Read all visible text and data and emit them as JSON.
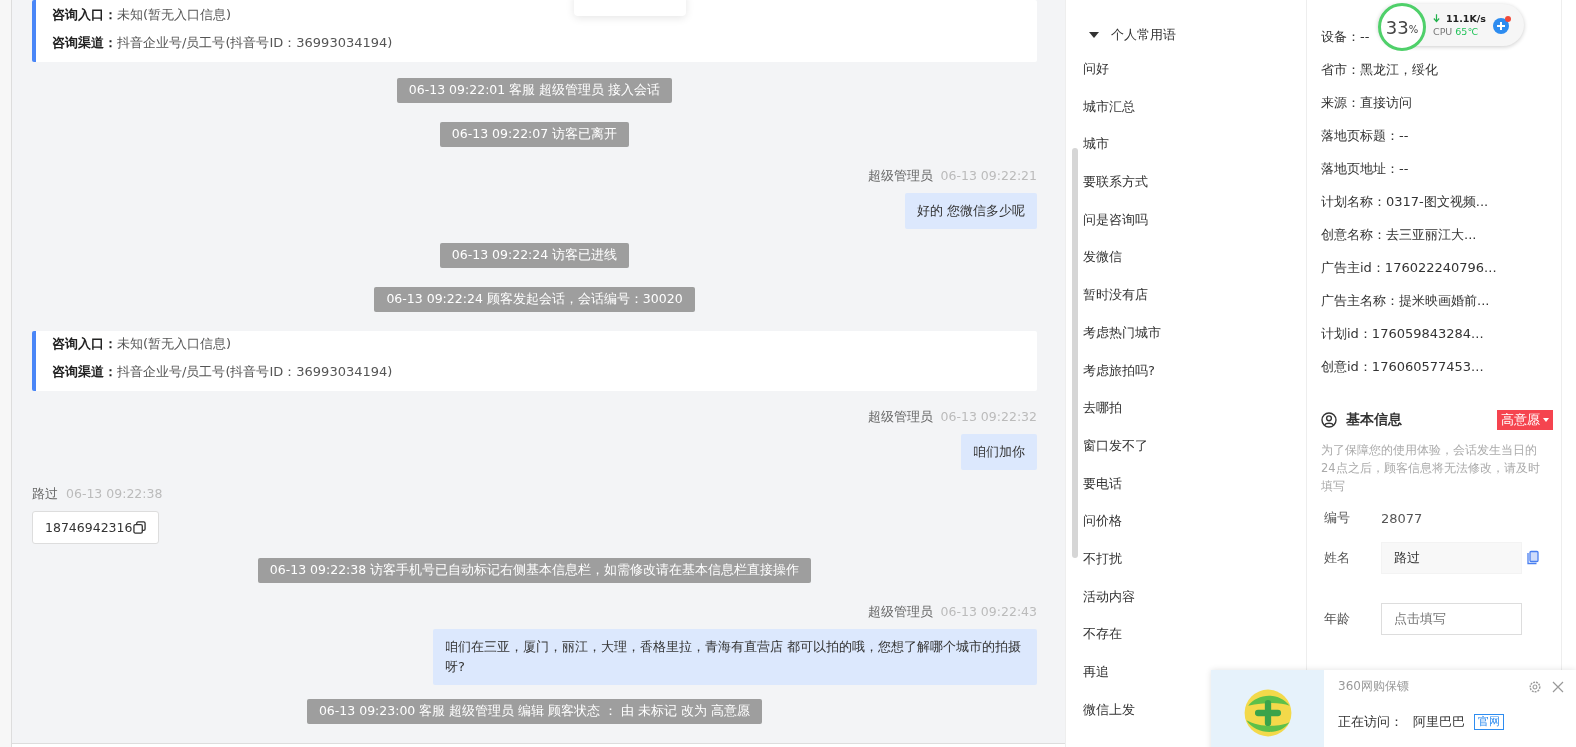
{
  "chat": {
    "messages": [
      {
        "kind": "info",
        "rows": [
          {
            "label": "咨询入口：",
            "value": "未知(暂无入口信息)"
          },
          {
            "label": "咨询渠道：",
            "value": "抖音企业号/员工号(抖音号ID：36993034194)"
          }
        ]
      },
      {
        "kind": "system",
        "text": "06-13 09:22:01 客服 超级管理员 接入会话"
      },
      {
        "kind": "system",
        "text": "06-13 09:22:07 访客已离开"
      },
      {
        "kind": "agent",
        "name": "超级管理员",
        "time": "06-13 09:22:21",
        "text": "好的 您微信多少呢"
      },
      {
        "kind": "system",
        "text": "06-13 09:22:24 访客已进线"
      },
      {
        "kind": "system",
        "text": "06-13 09:22:24 顾客发起会话，会话编号：30020"
      },
      {
        "kind": "info",
        "rows": [
          {
            "label": "咨询入口：",
            "value": "未知(暂无入口信息)"
          },
          {
            "label": "咨询渠道：",
            "value": "抖音企业号/员工号(抖音号ID：36993034194)"
          }
        ]
      },
      {
        "kind": "agent",
        "name": "超级管理员",
        "time": "06-13 09:22:32",
        "text": "咱们加你"
      },
      {
        "kind": "visitor",
        "name": "路过",
        "time": "06-13 09:22:38",
        "text": "18746942316"
      },
      {
        "kind": "system",
        "text": "06-13 09:22:38 访客手机号已自动标记右侧基本信息栏，如需修改请在基本信息栏直接操作"
      },
      {
        "kind": "agent",
        "name": "超级管理员",
        "time": "06-13 09:22:43",
        "text": "咱们在三亚，厦门，丽江，大理，香格里拉，青海有直营店 都可以拍的哦，您想了解哪个城市的拍摄呀?"
      },
      {
        "kind": "system",
        "text": "06-13 09:23:00 客服 超级管理员 编辑 顾客状态 ： 由 未标记 改为 高意愿"
      }
    ]
  },
  "phrases": {
    "group": "个人常用语",
    "expanded": true,
    "items": [
      "问好",
      "城市汇总",
      "城市",
      "要联系方式",
      "问是咨询吗",
      "发微信",
      "暂时没有店",
      "考虑热门城市",
      "考虑旅拍吗?",
      "去哪拍",
      "窗口发不了",
      "要电话",
      "问价格",
      "不打扰",
      "活动内容",
      "不存在",
      "再追",
      "微信上发"
    ]
  },
  "source_info": {
    "rows": [
      "设备：--",
      "省市：黑龙江，绥化",
      "来源：直接访问",
      "落地页标题：--",
      "落地页地址：--",
      "计划名称：0317-图文视频...",
      "创意名称：去三亚丽江大...",
      "广告主id：176022240796...",
      "广告主名称：提米映画婚前...",
      "计划id：176059843284...",
      "创意id：176060577453..."
    ]
  },
  "basic_info": {
    "title": "基本信息",
    "status": "高意愿",
    "notice": "为了保障您的使用体验，会话发生当日的24点之后，顾客信息将无法修改，请及时填写",
    "fields": [
      {
        "kind": "text",
        "label": "编号",
        "value": "28077"
      },
      {
        "kind": "input",
        "label": "姓名",
        "value": "路过"
      },
      {
        "kind": "input",
        "label": "年龄",
        "placeholder": "点击填写"
      }
    ]
  },
  "monitor": {
    "percent": "33",
    "unit": "%",
    "speed": "11.1K/s",
    "cpu_label": "CPU",
    "cpu_temp": "65℃"
  },
  "popup": {
    "title": "360网购保镖",
    "visiting_label": "正在访问：",
    "site": "阿里巴巴",
    "tag": "官网"
  }
}
